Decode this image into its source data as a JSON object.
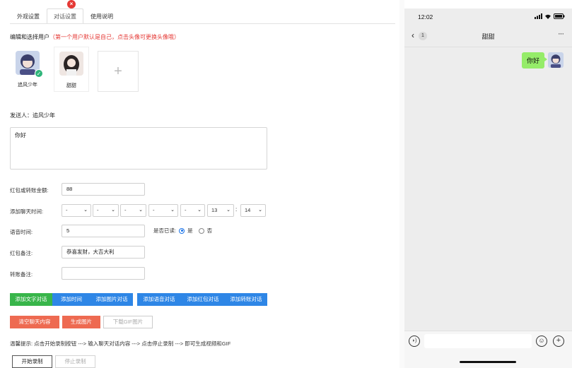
{
  "tabs": [
    "外观设置",
    "对话设置",
    "使用说明"
  ],
  "active_tab": "对话设置",
  "users_section": {
    "title": "编辑和选择用户",
    "hint": "（第一个用户默认是自己，点击头像可更换头像哦）",
    "users": [
      {
        "name": "追风少年",
        "selected": true
      },
      {
        "name": "甜甜",
        "deletable": true
      }
    ],
    "add_label": "+"
  },
  "sender": {
    "label": "发送人：",
    "name": "追风少年"
  },
  "message": {
    "value": "你好"
  },
  "form": {
    "redpacket_amount": {
      "label": "红包或转账金额:",
      "value": "88"
    },
    "chat_time": {
      "label": "添加聊天时间:",
      "selects": [
        "-",
        "-",
        "-",
        "-",
        "-",
        "13",
        "14"
      ],
      "separator": ":"
    },
    "voice_time": {
      "label": "语音时间:",
      "value": "5"
    },
    "read_status": {
      "label": "是否已读:",
      "yes": "是",
      "no": "否",
      "selected": "是"
    },
    "redpacket_note": {
      "label": "红包备注:",
      "value": "恭喜发财，大吉大利"
    },
    "transfer_note": {
      "label": "转账备注:",
      "value": ""
    }
  },
  "buttons": {
    "add_text": "添加文字对话",
    "add_time": "添加时间",
    "add_image": "添加图片对话",
    "add_voice": "添加语音对话",
    "add_redpacket": "添加红包对话",
    "add_transfer": "添加转账对话",
    "clear": "清空聊天内容",
    "gen_image": "生成图片",
    "download_gif": "下载GIF图片",
    "start_record": "开始录制",
    "stop_record": "停止录制"
  },
  "tip": "温馨提示: 点击开始录制按钮 ---> 输入聊天对话内容 ---> 点击停止录制 ---> 即可生成视频和GIF",
  "phone": {
    "time": "12:02",
    "back_count": "1",
    "chat_title": "甜甜",
    "more": "···",
    "messages": [
      {
        "text": "你好",
        "from": "me"
      }
    ]
  },
  "colors": {
    "green_button": "#38b54a",
    "blue_button": "#2e86e6",
    "red_button": "#ee6a51",
    "wechat_bubble": "#95ec69",
    "hint_red": "#e53935"
  }
}
